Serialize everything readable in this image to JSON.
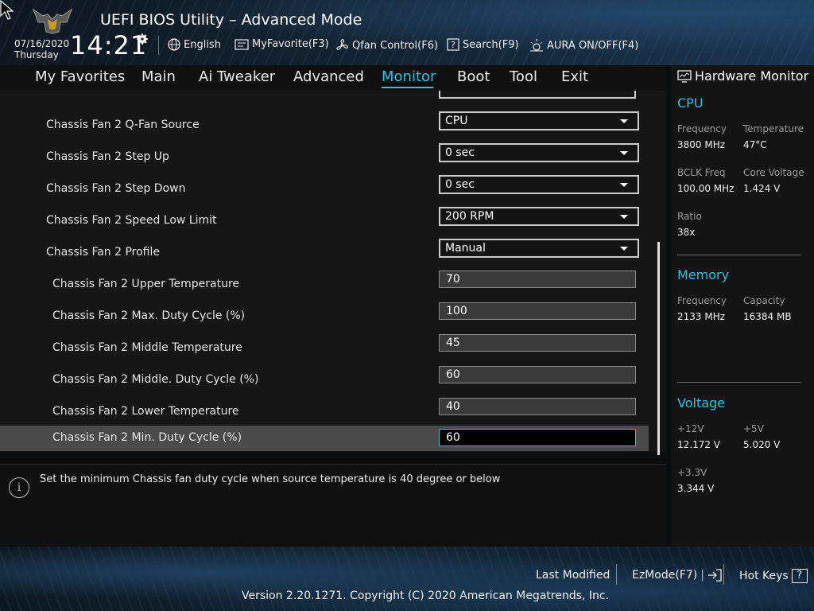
{
  "header": {
    "title": "UEFI BIOS Utility – Advanced Mode",
    "date": "07/16/2020",
    "day": "Thursday",
    "time": "14:21",
    "tools": {
      "language": "English",
      "myfavorite": "MyFavorite(F3)",
      "qfan": "Qfan Control(F6)",
      "search": "Search(F9)",
      "aura": "AURA ON/OFF(F4)"
    }
  },
  "nav": {
    "tabs": [
      "My Favorites",
      "Main",
      "Ai Tweaker",
      "Advanced",
      "Monitor",
      "Boot",
      "Tool",
      "Exit"
    ],
    "active": "Monitor"
  },
  "settings": [
    {
      "label": "Chassis Fan 2 Q-Fan Source",
      "value": "CPU",
      "type": "select"
    },
    {
      "label": "Chassis Fan 2 Step Up",
      "value": "0 sec",
      "type": "select"
    },
    {
      "label": "Chassis Fan 2 Step Down",
      "value": "0 sec",
      "type": "select"
    },
    {
      "label": "Chassis Fan 2 Speed Low Limit",
      "value": "200 RPM",
      "type": "select"
    },
    {
      "label": "Chassis Fan 2 Profile",
      "value": "Manual",
      "type": "select"
    },
    {
      "label": "Chassis Fan 2 Upper Temperature",
      "value": "70",
      "type": "field"
    },
    {
      "label": "Chassis Fan 2 Max. Duty Cycle (%)",
      "value": "100",
      "type": "field"
    },
    {
      "label": "Chassis Fan 2 Middle Temperature",
      "value": "45",
      "type": "field"
    },
    {
      "label": "Chassis Fan 2 Middle. Duty Cycle (%)",
      "value": "60",
      "type": "field"
    },
    {
      "label": "Chassis Fan 2 Lower Temperature",
      "value": "40",
      "type": "field"
    },
    {
      "label": "Chassis Fan 2 Min. Duty Cycle (%)",
      "value": "60",
      "type": "field",
      "selected": true
    }
  ],
  "help": {
    "text": "Set the minimum Chassis fan duty cycle when source temperature is 40 degree or below"
  },
  "hardware_monitor": {
    "title": "Hardware Monitor",
    "cpu": {
      "heading": "CPU",
      "frequency_label": "Frequency",
      "frequency": "3800 MHz",
      "temperature_label": "Temperature",
      "temperature": "47°C",
      "bclk_label": "BCLK Freq",
      "bclk": "100.00 MHz",
      "core_voltage_label": "Core Voltage",
      "core_voltage": "1.424 V",
      "ratio_label": "Ratio",
      "ratio": "38x"
    },
    "memory": {
      "heading": "Memory",
      "frequency_label": "Frequency",
      "frequency": "2133 MHz",
      "capacity_label": "Capacity",
      "capacity": "16384 MB"
    },
    "voltage": {
      "heading": "Voltage",
      "v12_label": "+12V",
      "v12": "12.172 V",
      "v5_label": "+5V",
      "v5": "5.020 V",
      "v33_label": "+3.3V",
      "v33": "3.344 V"
    }
  },
  "footer": {
    "last_modified": "Last Modified",
    "ezmode": "EzMode(F7)",
    "hotkeys": "Hot Keys",
    "hotkeys_key": "?",
    "copyright": "Version 2.20.1271. Copyright (C) 2020 American Megatrends, Inc."
  },
  "colors": {
    "accent": "#2bc2e8",
    "selected_row": "#4a4a4a"
  }
}
